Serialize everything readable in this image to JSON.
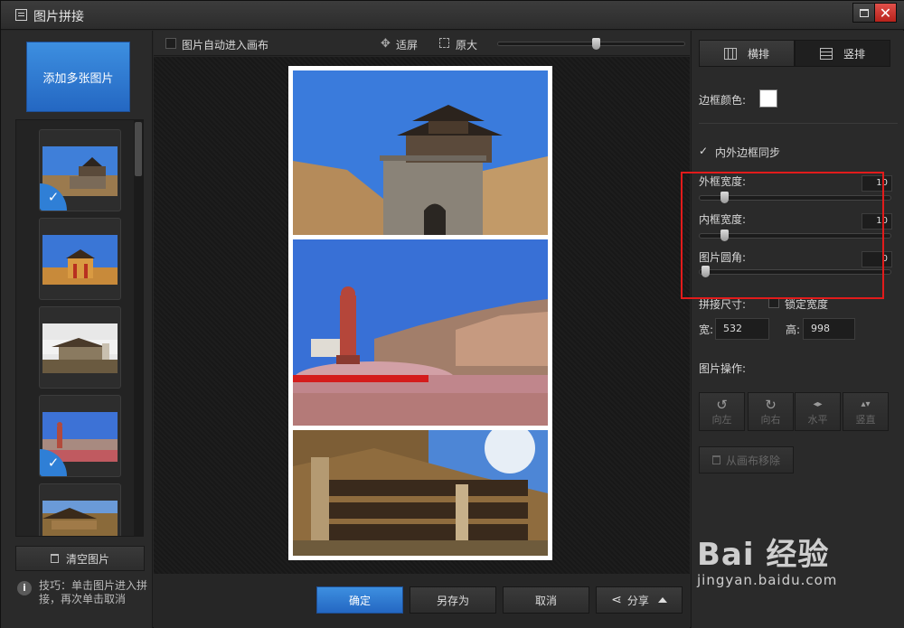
{
  "window": {
    "title": "图片拼接",
    "maximize_icon": "maximize-icon",
    "close_glyph": "✕"
  },
  "left": {
    "add_button": "添加多张图片",
    "thumbnails": [
      {
        "alt": "城楼",
        "selected": true
      },
      {
        "alt": "门楼",
        "selected": false
      },
      {
        "alt": "殿宇",
        "selected": false
      },
      {
        "alt": "雕像",
        "selected": true
      },
      {
        "alt": "石窟",
        "selected": false
      }
    ],
    "clear_button": "清空图片",
    "tip_icon": "i",
    "tip_text": "技巧：单击图片进入拼接，再次单击取消"
  },
  "toolbar": {
    "auto_canvas_label": "图片自动进入画布",
    "auto_canvas_checked": false,
    "fit_label": "适屏",
    "fit_icon": "✥",
    "original_label": "原大",
    "zoom_value": 0.52
  },
  "canvas": {
    "background": "#ffffff",
    "photos": [
      "城楼",
      "雕像",
      "石窟"
    ]
  },
  "actions": {
    "confirm": "确定",
    "save_as": "另存为",
    "cancel": "取消",
    "share": "分享",
    "share_icon": "⋖"
  },
  "right": {
    "layout_horizontal": "横排",
    "layout_vertical": "竖排",
    "active_layout": "竖排",
    "border_color_label": "边框颜色:",
    "border_color": "#ffffff",
    "sync_label": "内外边框同步",
    "sync_checked": true,
    "check_glyph": "✓",
    "outer_label": "外框宽度:",
    "outer_value": "10",
    "inner_label": "内框宽度:",
    "inner_value": "10",
    "corner_label": "图片圆角:",
    "corner_value": "0",
    "size_label": "拼接尺寸:",
    "lock_label": "锁定宽度",
    "width_label": "宽:",
    "width_value": "532",
    "height_label": "高:",
    "height_value": "998",
    "ops_label": "图片操作:",
    "op_left": "向左",
    "op_right": "向右",
    "op_flip_h": "水平",
    "op_flip_v": "竖直",
    "op_left_icon": "↺",
    "op_right_icon": "↻",
    "op_flip_h_icon": "◂▸",
    "op_flip_v_icon": "▴▾",
    "remove_label": "从画布移除"
  },
  "watermark": {
    "logo": "Bai 经验",
    "url": "jingyan.baidu.com"
  },
  "colors": {
    "accent": "#2f7fd6",
    "highlight": "#e21b1b",
    "close": "#c9302a"
  }
}
